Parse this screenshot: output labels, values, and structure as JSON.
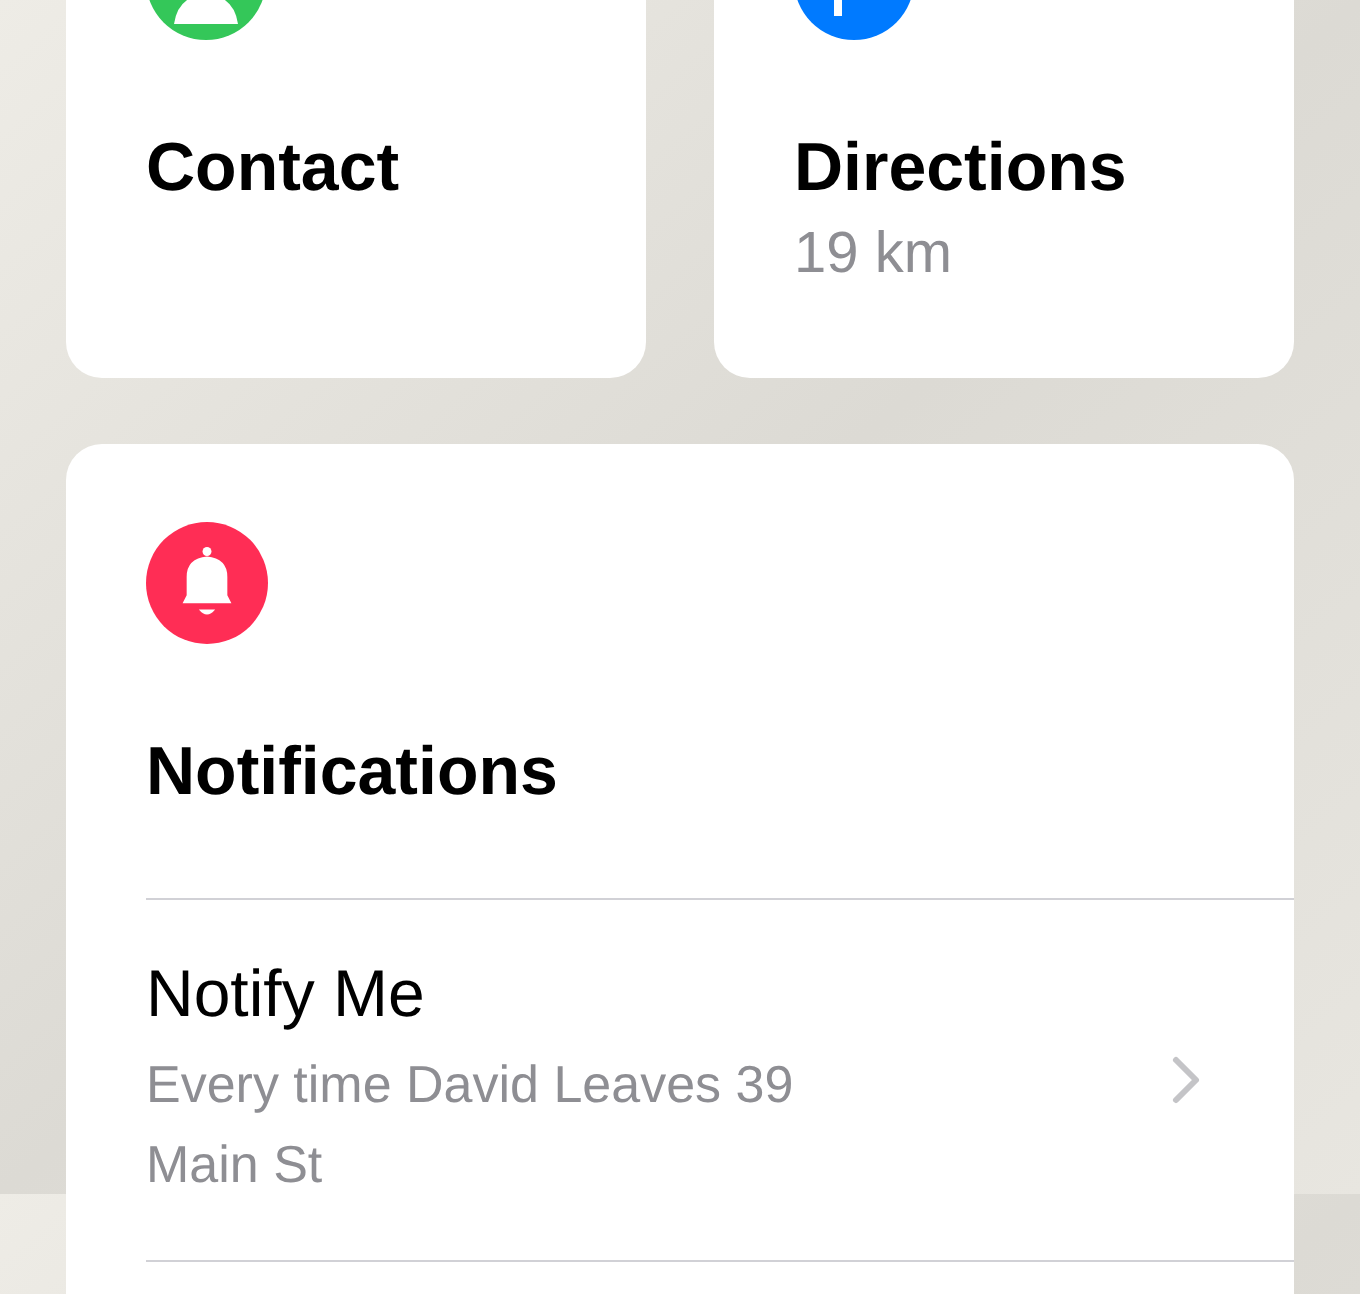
{
  "tiles": [
    {
      "kind": "contact",
      "title": "Contact",
      "color": "#34c759"
    },
    {
      "kind": "directions",
      "title": "Directions",
      "subtitle": "19 km",
      "color": "#007aff"
    }
  ],
  "notifications": {
    "title": "Notifications",
    "items": [
      {
        "title": "Notify Me",
        "subtitle": "Every time David Leaves 39 Main St"
      }
    ]
  }
}
